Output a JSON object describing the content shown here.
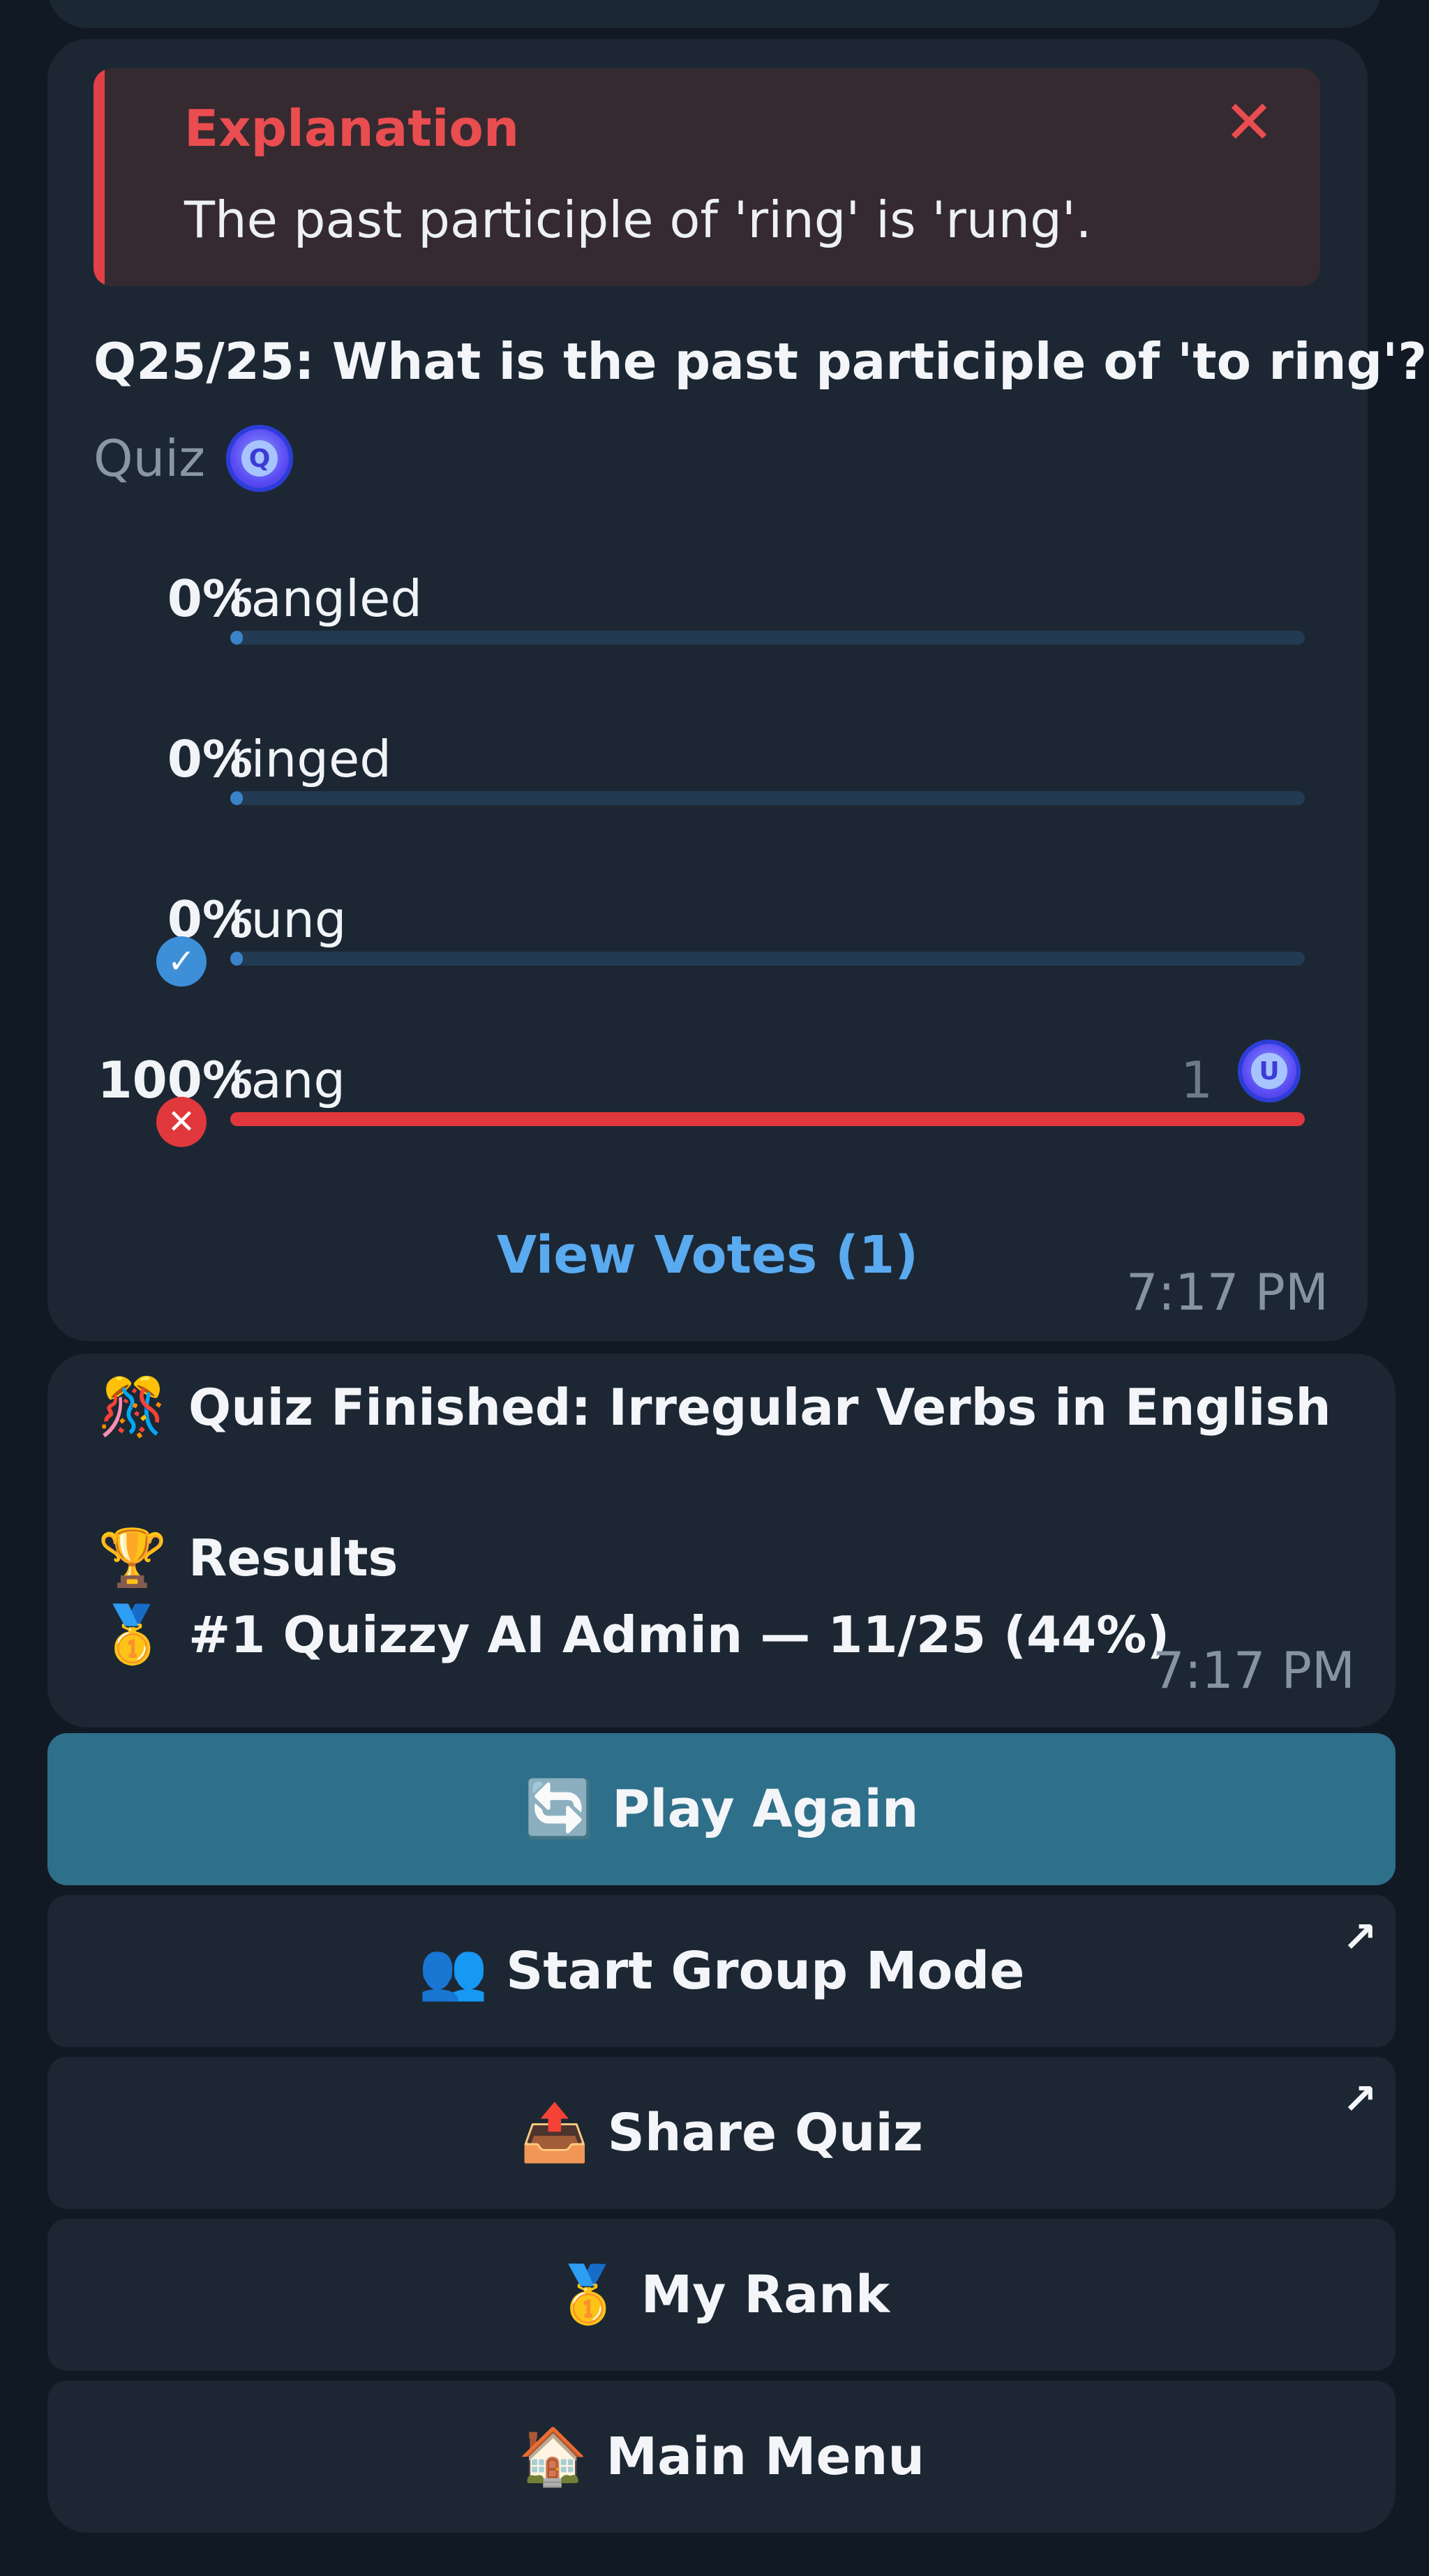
{
  "explanation": {
    "title": "Explanation",
    "text": "The past participle of 'ring' is 'rung'."
  },
  "poll": {
    "question": "Q25/25: What is the past participle of 'to ring'?",
    "type_label": "Quiz",
    "options": [
      {
        "percent_label": "0%",
        "label": "rangled",
        "fraction": 0,
        "status": "none"
      },
      {
        "percent_label": "0%",
        "label": "ringed",
        "fraction": 0,
        "status": "none"
      },
      {
        "percent_label": "0%",
        "label": "rung",
        "fraction": 0,
        "status": "correct"
      },
      {
        "percent_label": "100%",
        "label": "rang",
        "fraction": 1,
        "status": "wrong",
        "votes": "1"
      }
    ],
    "view_votes": "View Votes (1)",
    "time": "7:17 PM"
  },
  "result": {
    "title_emoji": "🎊",
    "title": "Quiz Finished: Irregular Verbs in English",
    "trophy_emoji": "🏆",
    "results_label": "Results",
    "medal_emoji": "🥇",
    "entry": "#1 Quizzy AI Admin — 11/25 (44%)",
    "time": "7:17 PM"
  },
  "buttons": {
    "play_again": {
      "emoji": "🔄",
      "label": "Play Again"
    },
    "group_mode": {
      "emoji": "👥",
      "label": "Start Group Mode"
    },
    "share": {
      "emoji": "📤",
      "label": "Share Quiz"
    },
    "rank": {
      "emoji": "🥇",
      "label": "My Rank"
    },
    "menu": {
      "emoji": "🏠",
      "label": "Main Menu"
    }
  },
  "colors": {
    "background": "#111a24",
    "card": "#1c2733",
    "accent_blue": "#5aaaf0",
    "wrong_red": "#e0383c",
    "primary_button": "#2e6f8a"
  }
}
